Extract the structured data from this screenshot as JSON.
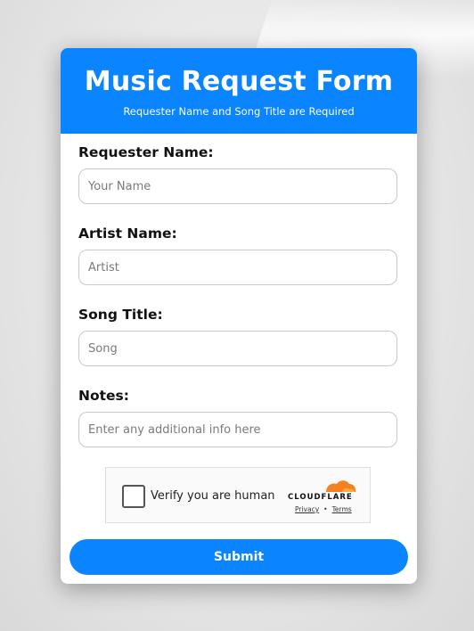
{
  "header": {
    "title": "Music Request Form",
    "subtitle": "Requester Name and Song Title are Required"
  },
  "fields": [
    {
      "label": "Requester Name:",
      "placeholder": "Your Name",
      "value": ""
    },
    {
      "label": "Artist Name:",
      "placeholder": "Artist",
      "value": ""
    },
    {
      "label": "Song Title:",
      "placeholder": "Song",
      "value": ""
    },
    {
      "label": "Notes:",
      "placeholder": "Enter any additional info here",
      "value": ""
    }
  ],
  "captcha": {
    "checkbox_label": "Verify you are human",
    "brand": "CLOUDFLARE",
    "privacy_link": "Privacy",
    "separator": "•",
    "terms_link": "Terms",
    "checked": false
  },
  "submit_label": "Submit",
  "colors": {
    "accent": "#0a84ff",
    "cloudflare_orange": "#f48120"
  }
}
